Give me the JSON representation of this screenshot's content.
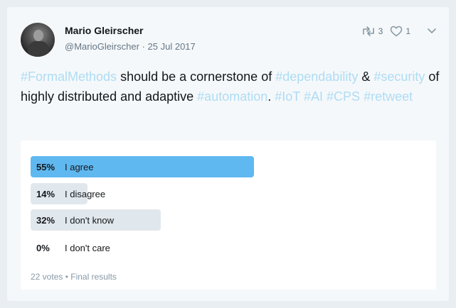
{
  "author": {
    "name": "Mario Gleirscher",
    "handle": "@MarioGleirscher",
    "date": "25 Jul 2017"
  },
  "actions": {
    "retweets": "3",
    "likes": "1"
  },
  "tweet": {
    "segments": [
      {
        "text": "#FormalMethods",
        "tag": true
      },
      {
        "text": " should be a cornerstone of ",
        "tag": false
      },
      {
        "text": "#dependability",
        "tag": true
      },
      {
        "text": " & ",
        "tag": false
      },
      {
        "text": "#security",
        "tag": true
      },
      {
        "text": " of highly distributed and adaptive ",
        "tag": false
      },
      {
        "text": "#automation",
        "tag": true
      },
      {
        "text": ". ",
        "tag": false
      },
      {
        "text": "#IoT",
        "tag": true
      },
      {
        "text": " ",
        "tag": false
      },
      {
        "text": "#AI",
        "tag": true
      },
      {
        "text": " ",
        "tag": false
      },
      {
        "text": "#CPS",
        "tag": true
      },
      {
        "text": " ",
        "tag": false
      },
      {
        "text": "#retweet",
        "tag": true
      }
    ]
  },
  "poll": {
    "options": [
      {
        "pct_label": "55%",
        "label": "I agree",
        "percent": 55,
        "winner": true
      },
      {
        "pct_label": "14%",
        "label": "I disagree",
        "percent": 14,
        "winner": false
      },
      {
        "pct_label": "32%",
        "label": "I don't know",
        "percent": 32,
        "winner": false
      },
      {
        "pct_label": "0%",
        "label": "I don't care",
        "percent": 0,
        "winner": false
      }
    ],
    "footer": "22 votes • Final results"
  },
  "colors": {
    "winner_bar": "#5fb8f0",
    "other_bar": "#e1e8ed",
    "hashtag": "#aedcf4"
  },
  "icons": {
    "retweet": "retweet-icon",
    "like": "heart-icon",
    "menu": "chevron-down-icon"
  }
}
